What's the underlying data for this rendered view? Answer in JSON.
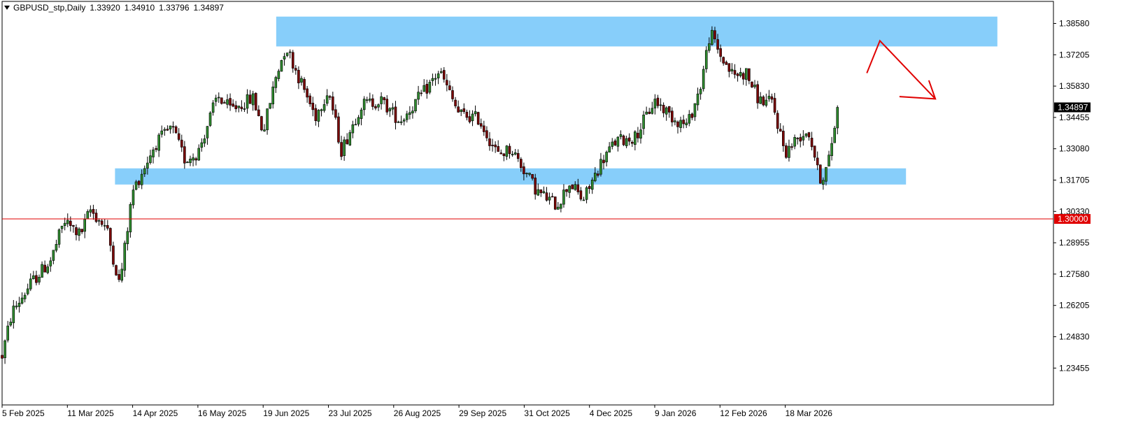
{
  "header": {
    "symbol": "GBPUSD_stp,Daily",
    "open": "1.33920",
    "high": "1.34910",
    "low": "1.33796",
    "close": "1.34897"
  },
  "colors": {
    "bull": "#2e8b2e",
    "bear": "#7a0000",
    "zone": "#87cefa",
    "hline": "#e00000",
    "arrow": "#e00000",
    "price_label_bg": "#000000",
    "hline_label_bg": "#e00000"
  },
  "chart_data": {
    "type": "candlestick",
    "instrument": "GBPUSD_stp",
    "timeframe": "Daily",
    "ylim": [
      1.229,
      1.39
    ],
    "y_ticks": [
      "1.38580",
      "1.37205",
      "1.35830",
      "1.34455",
      "1.33080",
      "1.31705",
      "1.30330",
      "1.28955",
      "1.27580",
      "1.26205",
      "1.24830",
      "1.23455"
    ],
    "x_ticks": [
      "5 Feb 2025",
      "11 Mar 2025",
      "14 Apr 2025",
      "16 May 2025",
      "19 Jun 2025",
      "23 Jul 2025",
      "26 Aug 2025",
      "29 Sep 2025",
      "31 Oct 2025",
      "4 Dec 2025",
      "9 Jan 2026",
      "12 Feb 2026",
      "18 Mar 2026"
    ],
    "current_price": "1.34897",
    "horizontal_line": {
      "value": 1.3,
      "label": "1.30000"
    },
    "zones": [
      {
        "from_tick": 4.2,
        "to_tick": 15.25,
        "low": 1.3757,
        "high": 1.3888
      },
      {
        "from_tick": 1.73,
        "to_tick": 13.85,
        "low": 1.3151,
        "high": 1.3222
      }
    ],
    "arrow": {
      "path_ticks": [
        [
          13.25,
          1.364
        ],
        [
          13.45,
          1.3782
        ],
        [
          14.3,
          1.3527
        ]
      ],
      "head_ticks": [
        [
          14.2,
          1.3608
        ],
        [
          14.3,
          1.3527
        ],
        [
          13.75,
          1.3537
        ]
      ]
    },
    "anchors": [
      [
        0,
        1.24
      ],
      [
        0.15,
        1.259
      ],
      [
        0.45,
        1.272
      ],
      [
        0.75,
        1.282
      ],
      [
        0.95,
        1.299
      ],
      [
        1.2,
        1.293
      ],
      [
        1.35,
        1.304
      ],
      [
        1.6,
        1.296
      ],
      [
        1.8,
        1.271
      ],
      [
        2.0,
        1.312
      ],
      [
        2.35,
        1.333
      ],
      [
        2.6,
        1.34
      ],
      [
        2.8,
        1.326
      ],
      [
        3.0,
        1.329
      ],
      [
        3.3,
        1.354
      ],
      [
        3.5,
        1.348
      ],
      [
        3.85,
        1.353
      ],
      [
        4.0,
        1.338
      ],
      [
        4.2,
        1.363
      ],
      [
        4.35,
        1.376
      ],
      [
        4.55,
        1.362
      ],
      [
        4.8,
        1.345
      ],
      [
        5.0,
        1.357
      ],
      [
        5.2,
        1.33
      ],
      [
        5.5,
        1.35
      ],
      [
        5.8,
        1.352
      ],
      [
        6.1,
        1.343
      ],
      [
        6.5,
        1.357
      ],
      [
        6.7,
        1.365
      ],
      [
        7.0,
        1.346
      ],
      [
        7.3,
        1.344
      ],
      [
        7.6,
        1.328
      ],
      [
        7.8,
        1.331
      ],
      [
        8.2,
        1.312
      ],
      [
        8.5,
        1.306
      ],
      [
        8.7,
        1.316
      ],
      [
        8.9,
        1.308
      ],
      [
        9.2,
        1.326
      ],
      [
        9.4,
        1.334
      ],
      [
        9.7,
        1.336
      ],
      [
        10.0,
        1.352
      ],
      [
        10.3,
        1.344
      ],
      [
        10.5,
        1.341
      ],
      [
        10.7,
        1.358
      ],
      [
        10.85,
        1.382
      ],
      [
        11.0,
        1.372
      ],
      [
        11.2,
        1.363
      ],
      [
        11.4,
        1.364
      ],
      [
        11.6,
        1.352
      ],
      [
        11.8,
        1.351
      ],
      [
        12.0,
        1.329
      ],
      [
        12.2,
        1.336
      ],
      [
        12.35,
        1.339
      ],
      [
        12.45,
        1.328
      ],
      [
        12.5,
        1.32
      ],
      [
        12.55,
        1.3175
      ],
      [
        12.65,
        1.323
      ],
      [
        12.75,
        1.34
      ],
      [
        12.8,
        1.349
      ]
    ]
  }
}
